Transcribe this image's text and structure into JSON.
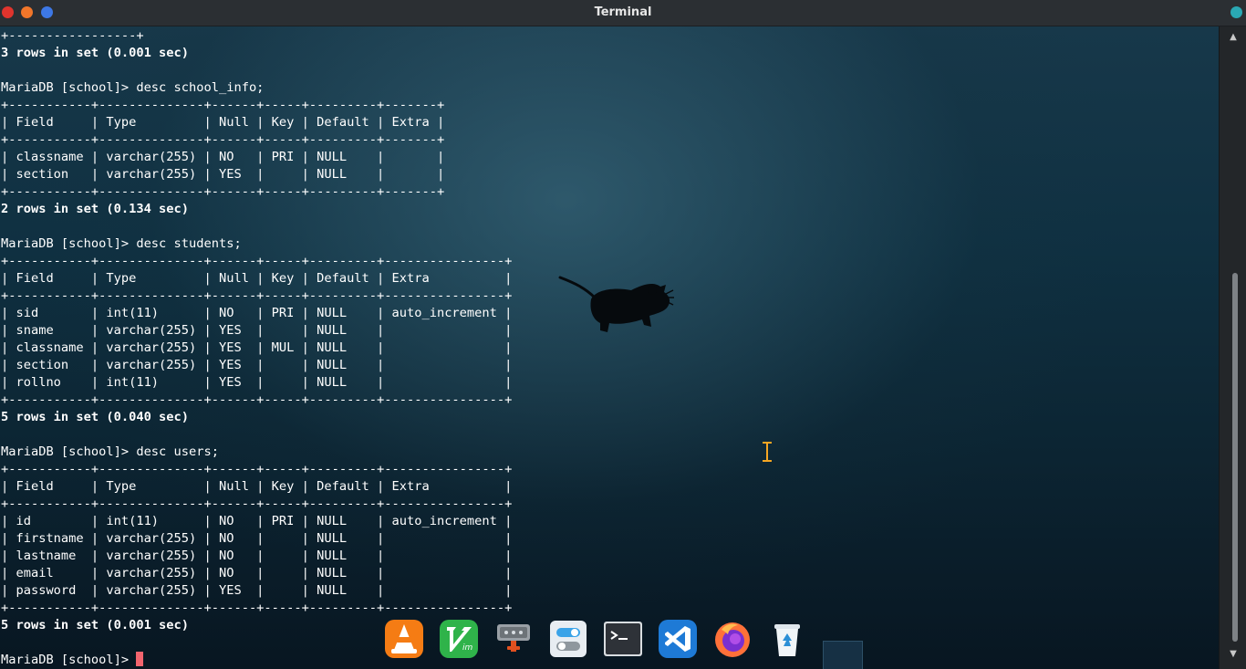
{
  "window": {
    "title": "Terminal"
  },
  "terminal": {
    "lines": [
      {
        "text": "+-----------------+",
        "bold": false
      },
      {
        "text": "3 rows in set (0.001 sec)",
        "bold": true
      },
      {
        "text": "",
        "bold": false
      },
      {
        "text": "MariaDB [school]> desc school_info;",
        "bold": false
      },
      {
        "text": "+-----------+--------------+------+-----+---------+-------+",
        "bold": false
      },
      {
        "text": "| Field     | Type         | Null | Key | Default | Extra |",
        "bold": false
      },
      {
        "text": "+-----------+--------------+------+-----+---------+-------+",
        "bold": false
      },
      {
        "text": "| classname | varchar(255) | NO   | PRI | NULL    |       |",
        "bold": false
      },
      {
        "text": "| section   | varchar(255) | YES  |     | NULL    |       |",
        "bold": false
      },
      {
        "text": "+-----------+--------------+------+-----+---------+-------+",
        "bold": false
      },
      {
        "text": "2 rows in set (0.134 sec)",
        "bold": true
      },
      {
        "text": "",
        "bold": false
      },
      {
        "text": "MariaDB [school]> desc students;",
        "bold": false
      },
      {
        "text": "+-----------+--------------+------+-----+---------+----------------+",
        "bold": false
      },
      {
        "text": "| Field     | Type         | Null | Key | Default | Extra          |",
        "bold": false
      },
      {
        "text": "+-----------+--------------+------+-----+---------+----------------+",
        "bold": false
      },
      {
        "text": "| sid       | int(11)      | NO   | PRI | NULL    | auto_increment |",
        "bold": false
      },
      {
        "text": "| sname     | varchar(255) | YES  |     | NULL    |                |",
        "bold": false
      },
      {
        "text": "| classname | varchar(255) | YES  | MUL | NULL    |                |",
        "bold": false
      },
      {
        "text": "| section   | varchar(255) | YES  |     | NULL    |                |",
        "bold": false
      },
      {
        "text": "| rollno    | int(11)      | YES  |     | NULL    |                |",
        "bold": false
      },
      {
        "text": "+-----------+--------------+------+-----+---------+----------------+",
        "bold": false
      },
      {
        "text": "5 rows in set (0.040 sec)",
        "bold": true
      },
      {
        "text": "",
        "bold": false
      },
      {
        "text": "MariaDB [school]> desc users;",
        "bold": false
      },
      {
        "text": "+-----------+--------------+------+-----+---------+----------------+",
        "bold": false
      },
      {
        "text": "| Field     | Type         | Null | Key | Default | Extra          |",
        "bold": false
      },
      {
        "text": "+-----------+--------------+------+-----+---------+----------------+",
        "bold": false
      },
      {
        "text": "| id        | int(11)      | NO   | PRI | NULL    | auto_increment |",
        "bold": false
      },
      {
        "text": "| firstname | varchar(255) | NO   |     | NULL    |                |",
        "bold": false
      },
      {
        "text": "| lastname  | varchar(255) | NO   |     | NULL    |                |",
        "bold": false
      },
      {
        "text": "| email     | varchar(255) | NO   |     | NULL    |                |",
        "bold": false
      },
      {
        "text": "| password  | varchar(255) | YES  |     | NULL    |                |",
        "bold": false
      },
      {
        "text": "+-----------+--------------+------+-----+---------+----------------+",
        "bold": false
      },
      {
        "text": "5 rows in set (0.001 sec)",
        "bold": true
      },
      {
        "text": "",
        "bold": false
      }
    ],
    "prompt": "MariaDB [school]> "
  },
  "dock": {
    "items": [
      {
        "name": "vlc-icon",
        "color": "#f57c14"
      },
      {
        "name": "vim-icon",
        "color": "#2fb34a"
      },
      {
        "name": "network-tool-icon",
        "color": "#9aa0a6"
      },
      {
        "name": "settings-toggle-icon",
        "color": "#e8edf2"
      },
      {
        "name": "terminal-icon",
        "color": "#2e3238"
      },
      {
        "name": "vscode-icon",
        "color": "#1e7ad6"
      },
      {
        "name": "firefox-icon",
        "color": "#ff7139"
      },
      {
        "name": "recycle-bin-icon",
        "color": "#2b8fd6"
      }
    ]
  },
  "colors": {
    "prompt_cursor": "#f2646e",
    "traffic_red": "#e0342d",
    "traffic_orange": "#f2762a",
    "traffic_blue": "#3d78e6"
  }
}
